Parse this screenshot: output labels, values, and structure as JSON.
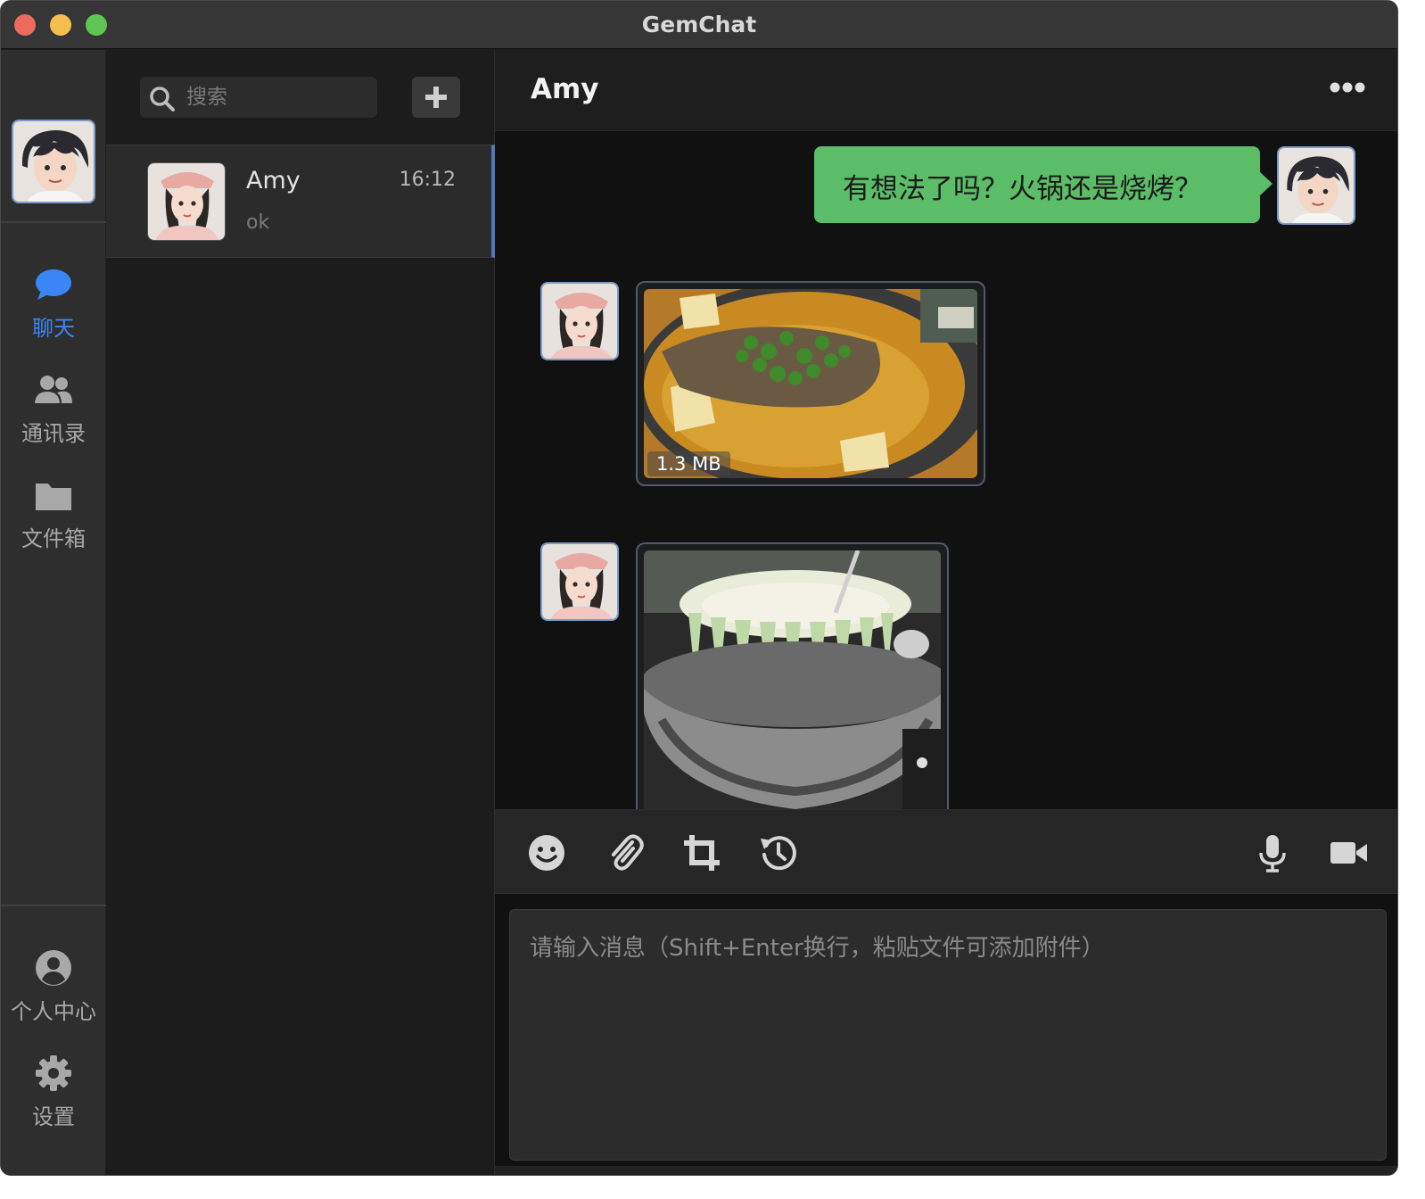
{
  "window": {
    "title": "GemChat"
  },
  "nav": {
    "items": [
      {
        "label": "聊天",
        "icon": "chat-bubble-icon",
        "active": true
      },
      {
        "label": "通讯录",
        "icon": "contacts-icon",
        "active": false
      },
      {
        "label": "文件箱",
        "icon": "folder-icon",
        "active": false
      }
    ],
    "bottom": [
      {
        "label": "个人中心",
        "icon": "user-circle-icon"
      },
      {
        "label": "设置",
        "icon": "gear-icon"
      }
    ]
  },
  "search": {
    "placeholder": "搜索",
    "value": ""
  },
  "conversations": [
    {
      "name": "Amy",
      "time": "16:12",
      "preview": "ok",
      "selected": true
    }
  ],
  "chat": {
    "title": "Amy",
    "messages": [
      {
        "direction": "out",
        "type": "text",
        "text": "有想法了吗？火锅还是烧烤？"
      },
      {
        "direction": "in",
        "type": "image",
        "size_label": "1.3 MB",
        "subject": "fish-hotpot-photo"
      },
      {
        "direction": "in",
        "type": "image",
        "size_label": "",
        "subject": "bbq-grill-photo"
      }
    ]
  },
  "toolbar": {
    "left_tools": [
      "emoji-icon",
      "attachment-icon",
      "crop-icon",
      "history-icon"
    ],
    "right_tools": [
      "microphone-icon",
      "video-call-icon"
    ]
  },
  "composer": {
    "placeholder": "请输入消息（Shift+Enter换行，粘贴文件可添加附件）",
    "value": ""
  },
  "colors": {
    "accent": "#3b86f7",
    "bubble_out": "#5bbd68",
    "window_bg": "#1c1c1c",
    "chat_bg": "#111111"
  }
}
